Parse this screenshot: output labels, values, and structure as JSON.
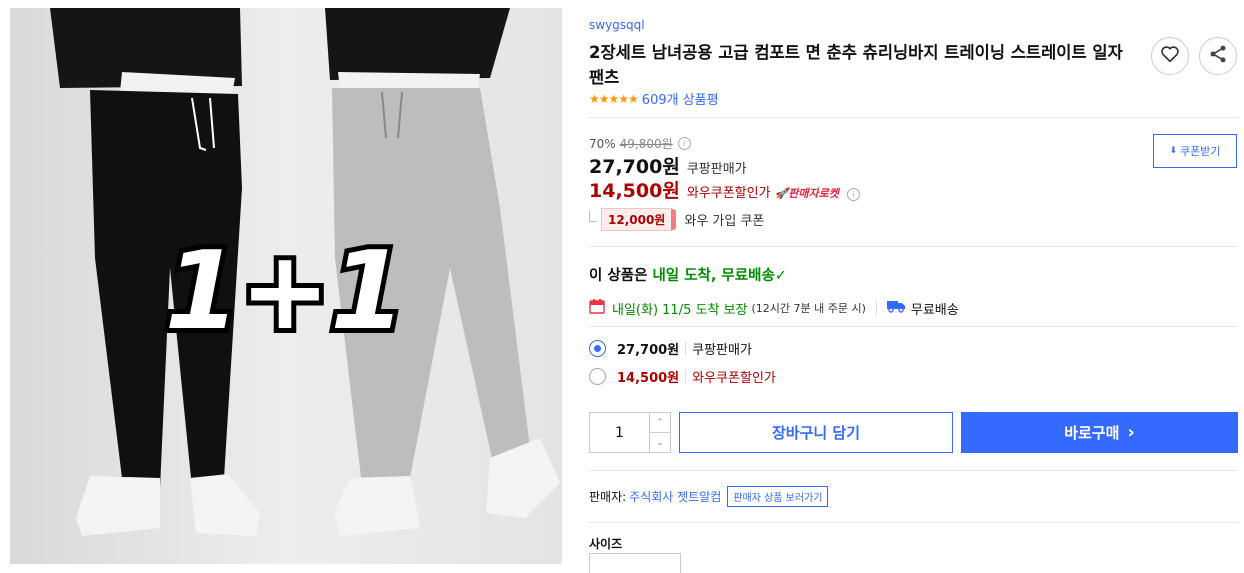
{
  "product_image": {
    "overlay_text": "1+1"
  },
  "brand": "swygsqql",
  "title": "2장세트 남녀공용 고급 컴포트 면 춘추 츄리닝바지 트레이닝 스트레이트 일자 팬츠",
  "rating": {
    "stars": "★★★★★",
    "count_text": "609개 상품평"
  },
  "price": {
    "discount_rate": "70%",
    "original": "49,800원",
    "info_icon": "i",
    "sale_price": "27,700원",
    "sale_label": "쿠팡판매가",
    "wow_price": "14,500원",
    "wow_label": "와우쿠폰할인가",
    "rocket_label": "🚀판매자로켓",
    "coupon_amount": "12,000원",
    "coupon_text": "와우 가입 쿠폰",
    "coupon_button": "쿠폰받기",
    "coupon_icon": "⬇"
  },
  "delivery": {
    "headline_prefix": "이 상품은 ",
    "headline_highlight": "내일 도착, 무료배송",
    "check": "✓",
    "arrival_text": "내일(화) 11/5 도착 보장",
    "arrival_note": "(12시간 7분 내 주문 시)",
    "shipping_text": "무료배송"
  },
  "options": [
    {
      "price": "27,700원",
      "label": "쿠팡판매가",
      "selected": true
    },
    {
      "price": "14,500원",
      "label": "와우쿠폰할인가",
      "selected": false
    }
  ],
  "quantity": {
    "value": "1",
    "up": "⌃",
    "down": "⌄"
  },
  "buttons": {
    "cart": "장바구니 담기",
    "buy": "바로구매",
    "buy_arrow": "›"
  },
  "seller": {
    "label": "판매자:",
    "name": "주식회사 젯트알컴",
    "view_button": "판매자 상품 보러가기"
  },
  "size": {
    "label": "사이즈"
  },
  "colors": {
    "accent": "#346aff",
    "red": "#ae0000",
    "green": "#008c00",
    "star": "#ff9a00"
  }
}
